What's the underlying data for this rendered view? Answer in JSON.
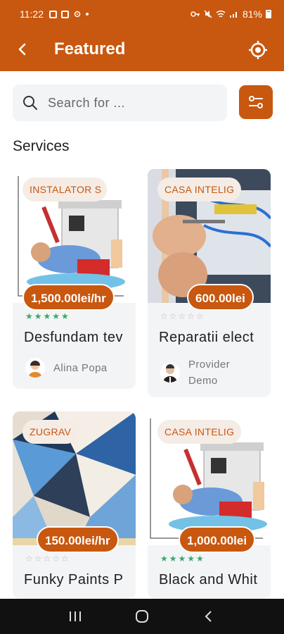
{
  "status_bar": {
    "time": "11:22",
    "battery": "81%"
  },
  "header": {
    "title": "Featured",
    "back_icon": "back-arrow-icon",
    "action_icon": "location-target-icon"
  },
  "search": {
    "placeholder": "Search for ...",
    "value": ""
  },
  "section": {
    "title": "Services"
  },
  "cards": [
    {
      "category": "INSTALATOR S",
      "price": "1,500.00lei/hr",
      "rating": 5,
      "title": "Desfundam tev",
      "provider": "Alina Popa"
    },
    {
      "category": "CASA INTELIG",
      "price": "600.00lei",
      "rating": 0,
      "title": "Reparatii elect",
      "provider": "Provider Demo"
    },
    {
      "category": "ZUGRAV",
      "price": "150.00lei/hr",
      "rating": 0,
      "title": "Funky Paints P",
      "provider": ""
    },
    {
      "category": "CASA INTELIG",
      "price": "1,000.00lei",
      "rating": 5,
      "title": "Black and Whit",
      "provider": ""
    }
  ],
  "colors": {
    "accent": "#c8570f",
    "card_bg": "#f3f4f6",
    "badge_bg": "#f5ece6",
    "star_full": "#3aa86b"
  }
}
